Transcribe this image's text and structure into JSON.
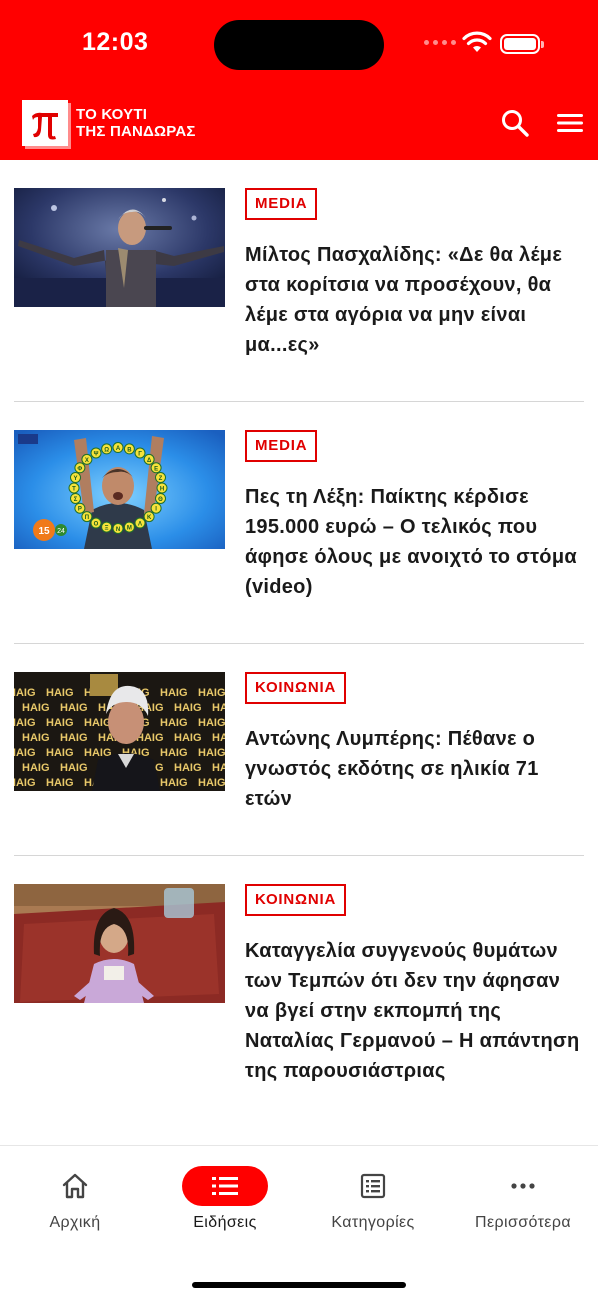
{
  "status_bar": {
    "time": "12:03"
  },
  "header": {
    "logo_line1": "ΤΟ ΚΟΥΤΙ",
    "logo_line2": "ΤΗΣ ΠΑΝΔΩΡΑΣ",
    "logo_icon": "pi-icon",
    "brand_color": "#ff0000"
  },
  "articles": [
    {
      "tag": "MEDIA",
      "title": "Μίλτος Πασχαλίδης: «Δε θα λέμε στα κορίτσια να προσέχουν, θα λέμε στα αγόρια να μην είναι μα...ες»"
    },
    {
      "tag": "MEDIA",
      "title": "Πες τη Λέξη: Παίκτης κέρδισε 195.000 ευρώ – Ο τελικός που άφησε όλους με ανοιχτό το στόμα (video)"
    },
    {
      "tag": "ΚΟΙΝΩΝΙΑ",
      "title": "Αντώνης Λυμπέρης: Πέθανε ο γνωστός εκδότης σε ηλικία 71 ετών"
    },
    {
      "tag": "ΚΟΙΝΩΝΙΑ",
      "title": "Καταγγελία συγγενούς θυμάτων των Τεμπών ότι δεν την άφησαν να βγεί στην εκπομπή της Ναταλίας Γερμανού – Η απάντηση της παρουσιάστριας"
    }
  ],
  "thumbs": {
    "letters": "ΑΒΓΔΕΖΗΘΙΚΛΜΝΞΟΠΡΣΤΥΦΧΨΩ",
    "quiz_score": "15",
    "quiz_timer": "24",
    "sponsor_text": "HAIG"
  },
  "nav": [
    {
      "label": "Αρχική",
      "icon": "home-icon"
    },
    {
      "label": "Ειδήσεις",
      "icon": "list-icon"
    },
    {
      "label": "Κατηγορίες",
      "icon": "newspaper-icon"
    },
    {
      "label": "Περισσότερα",
      "icon": "more-icon"
    }
  ]
}
